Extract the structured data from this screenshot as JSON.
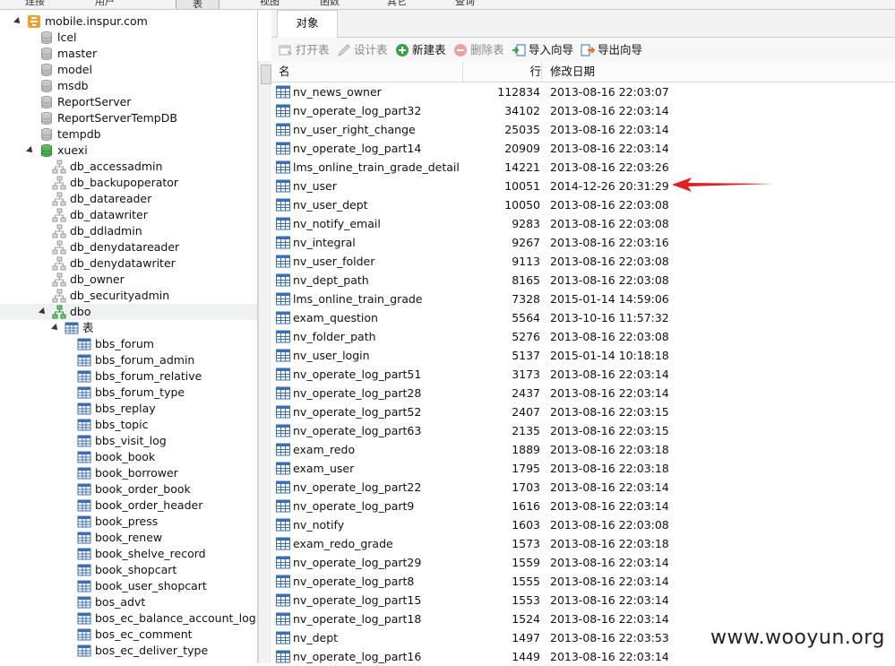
{
  "menubar": {
    "items": [
      "连接",
      "用户",
      "表",
      "视图",
      "函数",
      "其它",
      "查询"
    ]
  },
  "tree": {
    "server": "mobile.inspur.com",
    "databases": [
      "lcel",
      "master",
      "model",
      "msdb",
      "ReportServer",
      "ReportServerTempDB",
      "tempdb"
    ],
    "open_db": "xuexi",
    "schemas": [
      "db_accessadmin",
      "db_backupoperator",
      "db_datareader",
      "db_datawriter",
      "db_ddladmin",
      "db_denydatareader",
      "db_denydatawriter",
      "db_owner",
      "db_securityadmin"
    ],
    "open_schema": "dbo",
    "tables_folder": "表",
    "tables": [
      "bbs_forum",
      "bbs_forum_admin",
      "bbs_forum_relative",
      "bbs_forum_type",
      "bbs_replay",
      "bbs_topic",
      "bbs_visit_log",
      "book_book",
      "book_borrower",
      "book_order_book",
      "book_order_header",
      "book_press",
      "book_renew",
      "book_shelve_record",
      "book_shopcart",
      "book_user_shopcart",
      "bos_advt",
      "bos_ec_balance_account_log",
      "bos_ec_comment",
      "bos_ec_deliver_type"
    ]
  },
  "tab": {
    "label": "对象"
  },
  "toolbar": {
    "open": "打开表",
    "design": "设计表",
    "new": "新建表",
    "delete": "删除表",
    "import": "导入向导",
    "export": "导出向导"
  },
  "columns": {
    "name": "名",
    "rows": "行",
    "modified": "修改日期"
  },
  "rows": [
    {
      "name": "nv_news_owner",
      "rows": "112834",
      "date": "2013-08-16 22:03:07"
    },
    {
      "name": "nv_operate_log_part32",
      "rows": "34102",
      "date": "2013-08-16 22:03:14"
    },
    {
      "name": "nv_user_right_change",
      "rows": "25035",
      "date": "2013-08-16 22:03:14"
    },
    {
      "name": "nv_operate_log_part14",
      "rows": "20909",
      "date": "2013-08-16 22:03:14"
    },
    {
      "name": "lms_online_train_grade_detail",
      "rows": "14221",
      "date": "2013-08-16 22:03:26"
    },
    {
      "name": "nv_user",
      "rows": "10051",
      "date": "2014-12-26 20:31:29"
    },
    {
      "name": "nv_user_dept",
      "rows": "10050",
      "date": "2013-08-16 22:03:08"
    },
    {
      "name": "nv_notify_email",
      "rows": "9283",
      "date": "2013-08-16 22:03:08"
    },
    {
      "name": "nv_integral",
      "rows": "9267",
      "date": "2013-08-16 22:03:16"
    },
    {
      "name": "nv_user_folder",
      "rows": "9113",
      "date": "2013-08-16 22:03:08"
    },
    {
      "name": "nv_dept_path",
      "rows": "8165",
      "date": "2013-08-16 22:03:08"
    },
    {
      "name": "lms_online_train_grade",
      "rows": "7328",
      "date": "2015-01-14 14:59:06"
    },
    {
      "name": "exam_question",
      "rows": "5564",
      "date": "2013-10-16 11:57:32"
    },
    {
      "name": "nv_folder_path",
      "rows": "5276",
      "date": "2013-08-16 22:03:08"
    },
    {
      "name": "nv_user_login",
      "rows": "5137",
      "date": "2015-01-14 10:18:18"
    },
    {
      "name": "nv_operate_log_part51",
      "rows": "3173",
      "date": "2013-08-16 22:03:14"
    },
    {
      "name": "nv_operate_log_part28",
      "rows": "2437",
      "date": "2013-08-16 22:03:14"
    },
    {
      "name": "nv_operate_log_part52",
      "rows": "2407",
      "date": "2013-08-16 22:03:15"
    },
    {
      "name": "nv_operate_log_part63",
      "rows": "2135",
      "date": "2013-08-16 22:03:15"
    },
    {
      "name": "exam_redo",
      "rows": "1889",
      "date": "2013-08-16 22:03:18"
    },
    {
      "name": "exam_user",
      "rows": "1795",
      "date": "2013-08-16 22:03:18"
    },
    {
      "name": "nv_operate_log_part22",
      "rows": "1703",
      "date": "2013-08-16 22:03:14"
    },
    {
      "name": "nv_operate_log_part9",
      "rows": "1616",
      "date": "2013-08-16 22:03:14"
    },
    {
      "name": "nv_notify",
      "rows": "1603",
      "date": "2013-08-16 22:03:08"
    },
    {
      "name": "exam_redo_grade",
      "rows": "1573",
      "date": "2013-08-16 22:03:18"
    },
    {
      "name": "nv_operate_log_part29",
      "rows": "1559",
      "date": "2013-08-16 22:03:14"
    },
    {
      "name": "nv_operate_log_part8",
      "rows": "1555",
      "date": "2013-08-16 22:03:14"
    },
    {
      "name": "nv_operate_log_part15",
      "rows": "1553",
      "date": "2013-08-16 22:03:14"
    },
    {
      "name": "nv_operate_log_part18",
      "rows": "1524",
      "date": "2013-08-16 22:03:14"
    },
    {
      "name": "nv_dept",
      "rows": "1497",
      "date": "2013-08-16 22:03:53"
    },
    {
      "name": "nv_operate_log_part16",
      "rows": "1449",
      "date": "2013-08-16 22:03:14"
    }
  ],
  "watermark": "www.wooyun.org",
  "colors": {
    "annotation_arrow": "#e02020",
    "db_icon": "#bdbdbd",
    "db_open": "#3aa04a",
    "table_icon": "#3b6fb5"
  }
}
